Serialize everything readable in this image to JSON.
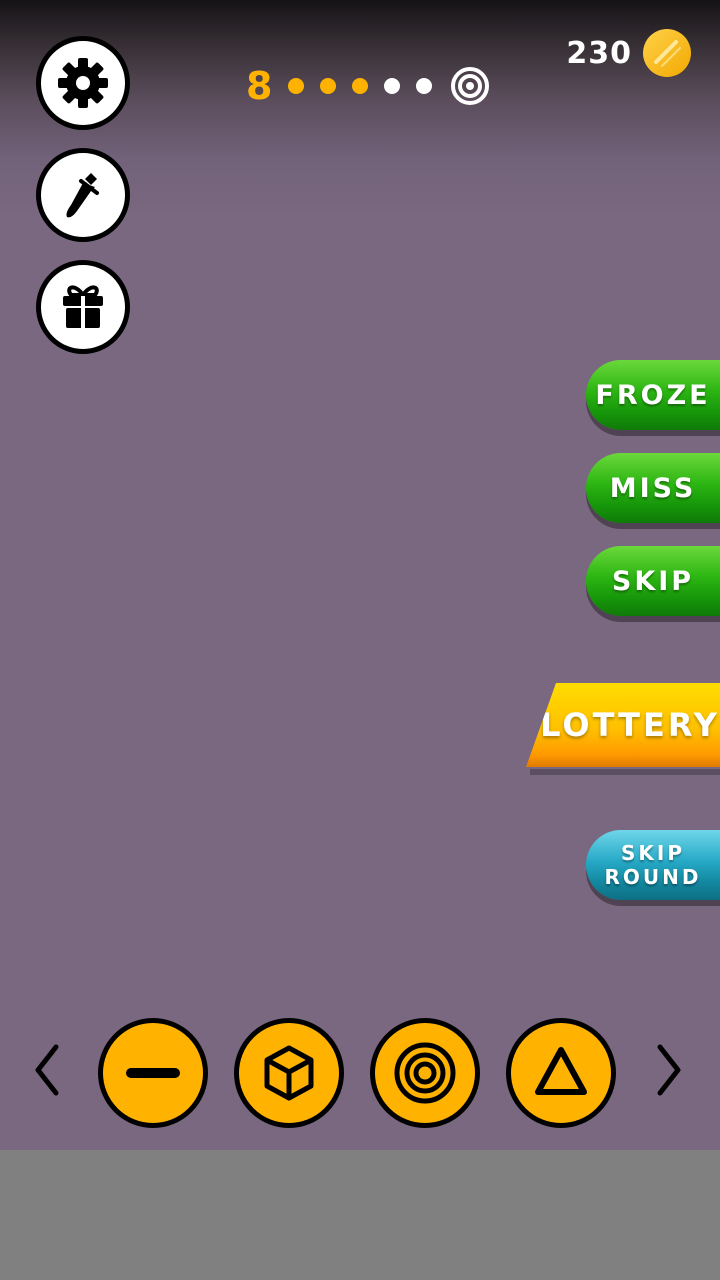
{
  "hud": {
    "coins": "230",
    "level": "8",
    "progress_dots": [
      "done",
      "done",
      "done",
      "todo",
      "todo"
    ]
  },
  "left_menu": {
    "icons": [
      "gear-icon",
      "knife-icon",
      "gift-icon"
    ]
  },
  "powerups": {
    "froze": "FROZE",
    "miss": "MISS",
    "skip": "SKIP",
    "lottery": "LOTTERY",
    "skip_round_line1": "SKIP",
    "skip_round_line2": "ROUND"
  },
  "shape_selector": {
    "shapes": [
      "line-icon",
      "cube-icon",
      "target-rings-icon",
      "triangle-icon"
    ]
  },
  "colors": {
    "accent_orange": "#ffb300",
    "green_button": "#2bb512",
    "blue_button": "#26a9c6",
    "background": "#7a6880",
    "bottom_bar": "#808080"
  }
}
